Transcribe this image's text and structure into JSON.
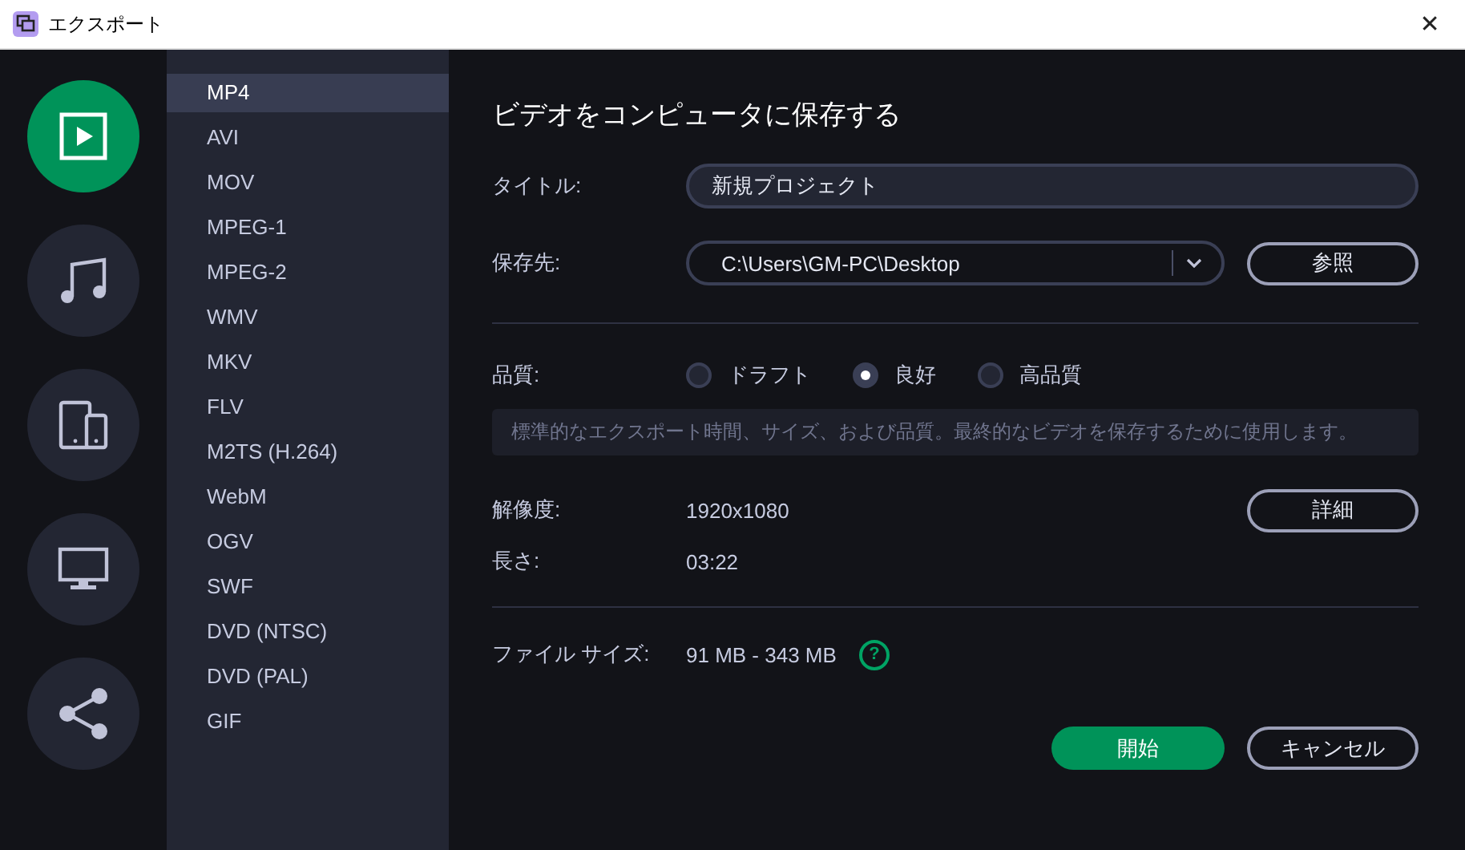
{
  "window": {
    "title": "エクスポート",
    "close": "✕"
  },
  "categories": [
    {
      "kind": "video",
      "selected": true
    },
    {
      "kind": "music",
      "selected": false
    },
    {
      "kind": "devices",
      "selected": false
    },
    {
      "kind": "tv",
      "selected": false
    },
    {
      "kind": "share",
      "selected": false
    }
  ],
  "formats": [
    {
      "label": "MP4",
      "selected": true
    },
    {
      "label": "AVI",
      "selected": false
    },
    {
      "label": "MOV",
      "selected": false
    },
    {
      "label": "MPEG-1",
      "selected": false
    },
    {
      "label": "MPEG-2",
      "selected": false
    },
    {
      "label": "WMV",
      "selected": false
    },
    {
      "label": "MKV",
      "selected": false
    },
    {
      "label": "FLV",
      "selected": false
    },
    {
      "label": "M2TS (H.264)",
      "selected": false
    },
    {
      "label": "WebM",
      "selected": false
    },
    {
      "label": "OGV",
      "selected": false
    },
    {
      "label": "SWF",
      "selected": false
    },
    {
      "label": "DVD (NTSC)",
      "selected": false
    },
    {
      "label": "DVD (PAL)",
      "selected": false
    },
    {
      "label": "GIF",
      "selected": false
    }
  ],
  "heading": "ビデオをコンピュータに保存する",
  "title_field": {
    "label": "タイトル:",
    "value": "新規プロジェクト"
  },
  "destination": {
    "label": "保存先:",
    "value": "C:\\Users\\GM-PC\\Desktop",
    "browse": "参照"
  },
  "quality": {
    "label": "品質:",
    "options": [
      {
        "label": "ドラフト",
        "selected": false
      },
      {
        "label": "良好",
        "selected": true
      },
      {
        "label": "高品質",
        "selected": false
      }
    ],
    "hint": "標準的なエクスポート時間、サイズ、および品質。最終的なビデオを保存するために使用します。"
  },
  "resolution": {
    "label": "解像度:",
    "value": "1920x1080",
    "details": "詳細"
  },
  "length": {
    "label": "長さ:",
    "value": "03:22"
  },
  "file_size": {
    "label": "ファイル サイズ:",
    "value": "91 MB - 343 MB",
    "help": "?"
  },
  "buttons": {
    "start": "開始",
    "cancel": "キャンセル"
  }
}
